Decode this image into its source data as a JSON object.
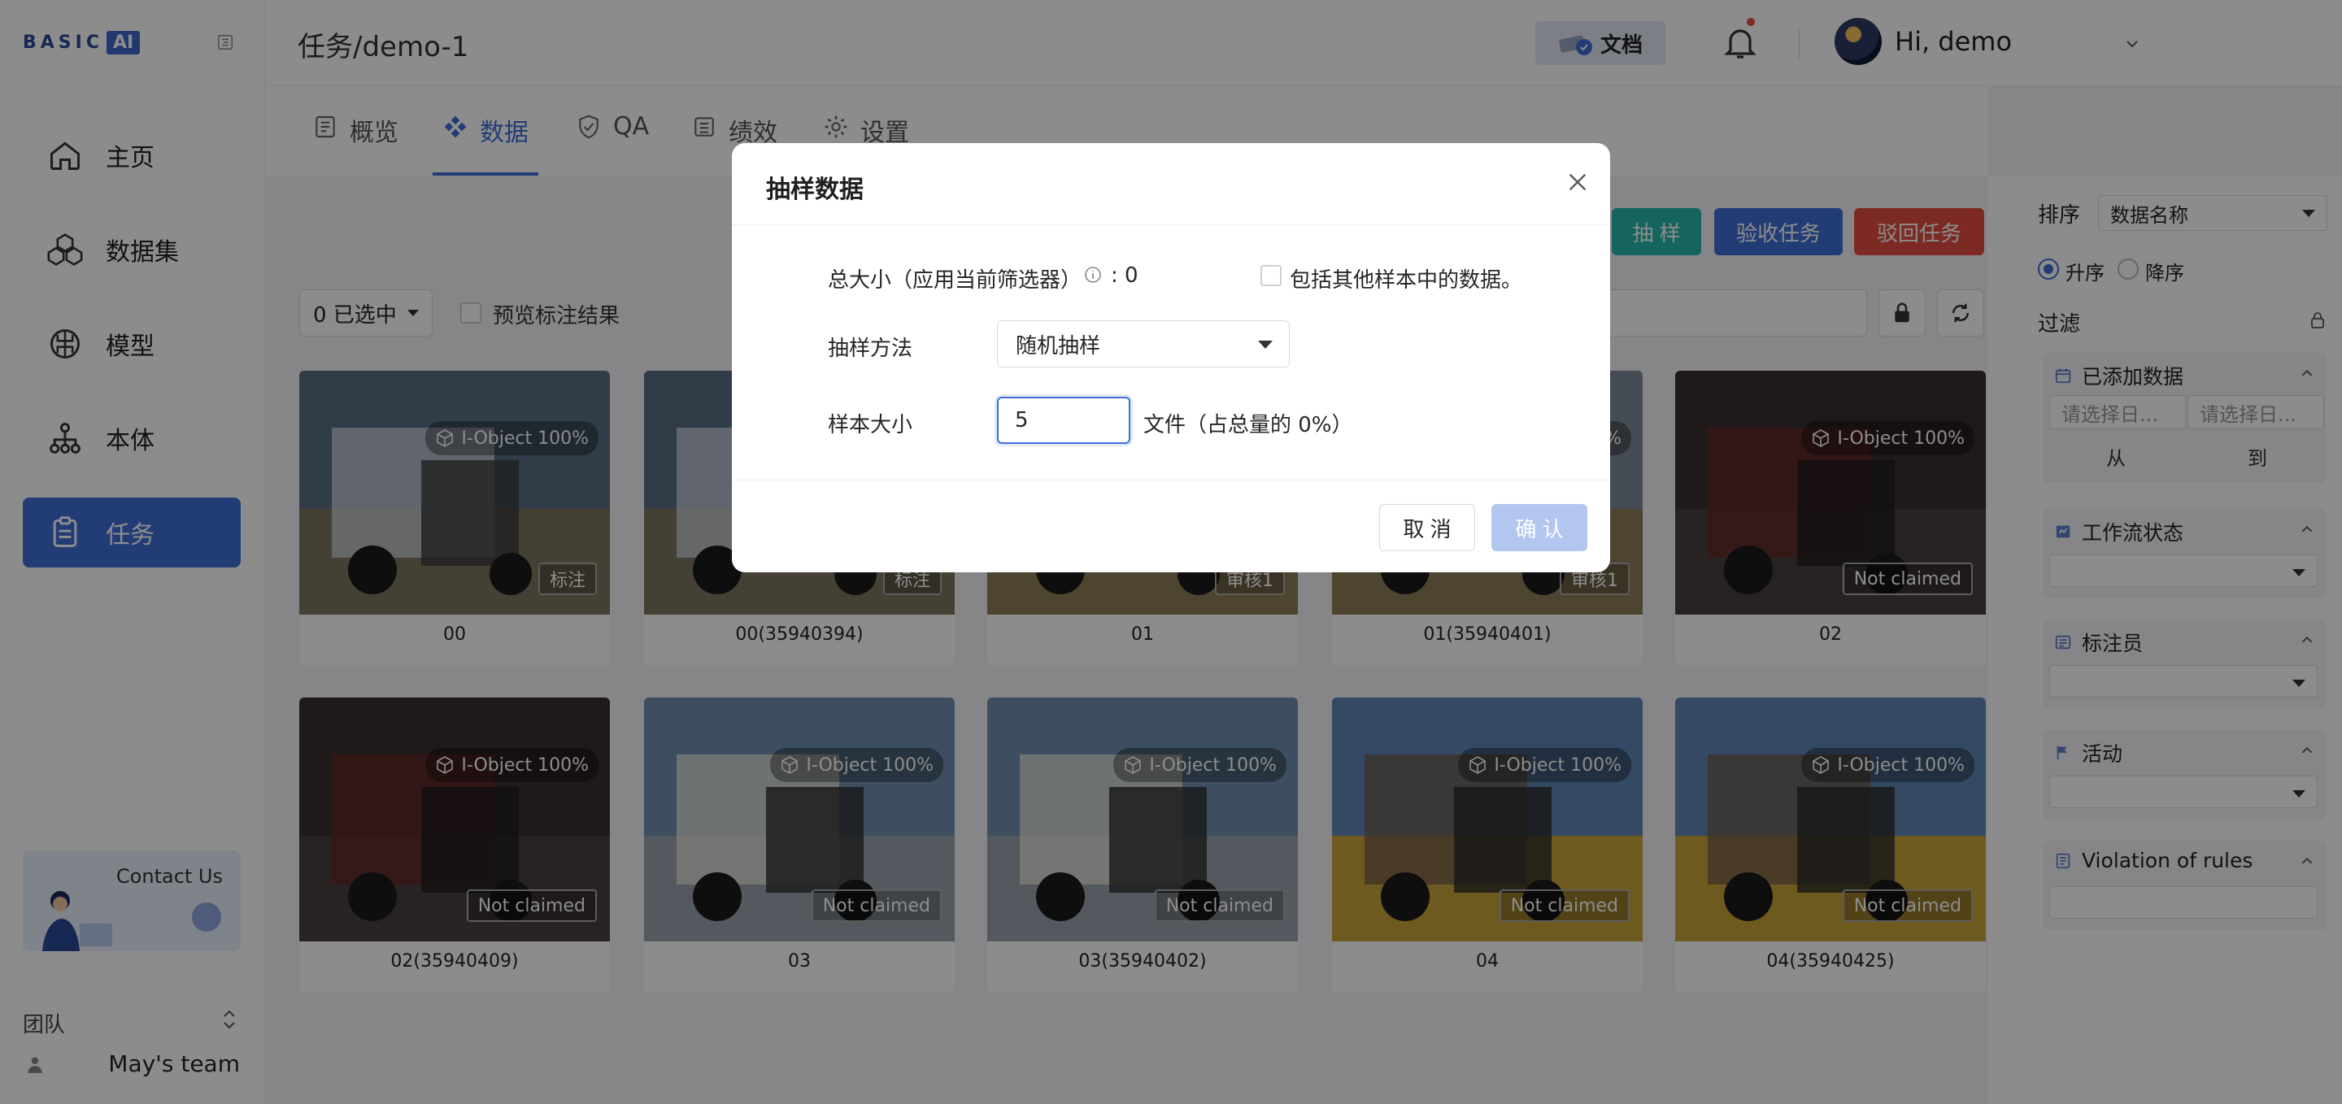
{
  "brand": {
    "logo_text": "BASIC",
    "logo_box": "AI"
  },
  "sidebar": {
    "items": [
      {
        "label": "主页",
        "icon": "home-icon"
      },
      {
        "label": "数据集",
        "icon": "dataset-icon"
      },
      {
        "label": "模型",
        "icon": "model-icon"
      },
      {
        "label": "本体",
        "icon": "ontology-icon"
      },
      {
        "label": "任务",
        "icon": "task-icon",
        "active": true
      }
    ],
    "contact": "Contact Us",
    "team_label": "团队",
    "team_name": "May's team"
  },
  "header": {
    "breadcrumb": "任务/demo-1",
    "docs_label": "文档",
    "greeting": "Hi, demo"
  },
  "tabs": [
    {
      "label": "概览",
      "icon": "overview-icon"
    },
    {
      "label": "数据",
      "icon": "data-icon",
      "active": true
    },
    {
      "label": "QA",
      "icon": "qa-shield-icon"
    },
    {
      "label": "绩效",
      "icon": "performance-icon"
    },
    {
      "label": "设置",
      "icon": "settings-icon"
    }
  ],
  "toolbar": {
    "sample_btn": "抽 样",
    "accept_btn": "验收任务",
    "reject_btn": "驳回任务",
    "selected": "0 已选中",
    "preview_label": "预览标注结果"
  },
  "grid": {
    "object_badge": "I-Object 100%",
    "items": [
      {
        "name": "00",
        "status": "标注"
      },
      {
        "name": "00(35940394)",
        "status": "标注"
      },
      {
        "name": "01",
        "status": "审核1"
      },
      {
        "name": "01(35940401)",
        "status": "审核1"
      },
      {
        "name": "02",
        "status": "Not claimed"
      },
      {
        "name": "02(35940409)",
        "status": "Not claimed"
      },
      {
        "name": "03",
        "status": "Not claimed"
      },
      {
        "name": "03(35940402)",
        "status": "Not claimed"
      },
      {
        "name": "04",
        "status": "Not claimed"
      },
      {
        "name": "04(35940425)",
        "status": "Not claimed"
      }
    ]
  },
  "right_panel": {
    "sort_label": "排序",
    "sort_value": "数据名称",
    "asc": "升序",
    "desc": "降序",
    "filter_label": "过滤",
    "date_group": {
      "title": "已添加数据",
      "placeholder_from": "请选择日...",
      "placeholder_to": "请选择日...",
      "from": "从",
      "to": "到"
    },
    "workflow_title": "工作流状态",
    "annotator_title": "标注员",
    "activity_title": "活动",
    "violation_title": "Violation of rules"
  },
  "modal": {
    "title": "抽样数据",
    "total_label": "总大小（应用当前筛选器）",
    "total_value": ": 0",
    "include_other": "包括其他样本中的数据。",
    "method_label": "抽样方法",
    "method_value": "随机抽样",
    "size_label": "样本大小",
    "size_value": "5",
    "size_suffix": "文件（占总量的 0%）",
    "cancel": "取 消",
    "confirm": "确 认"
  },
  "colors": {
    "primary": "#3f6fd6",
    "teal": "#27b7a9",
    "danger": "#e54d42"
  }
}
